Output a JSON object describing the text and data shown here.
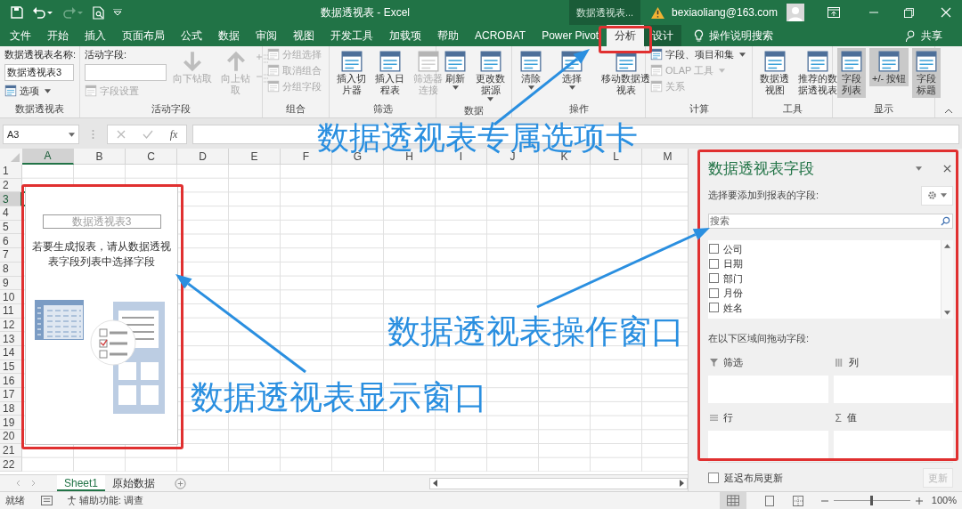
{
  "title_bar": {
    "title": "数据透视表 - Excel",
    "context_label": "数据透视表...",
    "account": "bexiaoliang@163.com"
  },
  "tabs": [
    {
      "label": "文件",
      "selected": false,
      "contextual": false
    },
    {
      "label": "开始",
      "selected": false,
      "contextual": false
    },
    {
      "label": "插入",
      "selected": false,
      "contextual": false
    },
    {
      "label": "页面布局",
      "selected": false,
      "contextual": false
    },
    {
      "label": "公式",
      "selected": false,
      "contextual": false
    },
    {
      "label": "数据",
      "selected": false,
      "contextual": false
    },
    {
      "label": "审阅",
      "selected": false,
      "contextual": false
    },
    {
      "label": "视图",
      "selected": false,
      "contextual": false
    },
    {
      "label": "开发工具",
      "selected": false,
      "contextual": false
    },
    {
      "label": "加载项",
      "selected": false,
      "contextual": false
    },
    {
      "label": "帮助",
      "selected": false,
      "contextual": false
    },
    {
      "label": "ACROBAT",
      "selected": false,
      "contextual": false
    },
    {
      "label": "Power Pivot",
      "selected": false,
      "contextual": false
    },
    {
      "label": "分析",
      "selected": true,
      "contextual": true
    },
    {
      "label": "设计",
      "selected": false,
      "contextual": true
    }
  ],
  "tell_me": "操作说明搜索",
  "share": "共享",
  "ribbon": [
    {
      "label": "数据透视表",
      "items": [
        {
          "kind": "caption",
          "label": "数据透视表名称:"
        },
        {
          "kind": "field",
          "value": "数据透视表3"
        },
        {
          "kind": "menu",
          "label": "选项",
          "disabled": false
        }
      ]
    },
    {
      "label": "活动字段",
      "items": [
        {
          "kind": "caption",
          "label": "活动字段:"
        },
        {
          "kind": "field"
        },
        {
          "kind": "small",
          "label": "字段设置",
          "disabled": true
        },
        {
          "kind": "arrow-down",
          "label": "向下钻取",
          "disabled": true
        },
        {
          "kind": "arrow-up",
          "label": "向上钻取",
          "disabled": true
        },
        {
          "kind": "expand-collapse",
          "disabled": true
        }
      ]
    },
    {
      "label": "组合",
      "items": [
        {
          "kind": "small",
          "label": "分组选择",
          "disabled": true
        },
        {
          "kind": "small",
          "label": "取消组合",
          "disabled": true
        },
        {
          "kind": "small",
          "label": "分组字段",
          "disabled": true
        }
      ]
    },
    {
      "label": "筛选",
      "items": [
        {
          "kind": "big",
          "label": "插入切片器",
          "disabled": false
        },
        {
          "kind": "big",
          "label": "插入日程表",
          "disabled": false
        },
        {
          "kind": "big",
          "label": "筛选器连接",
          "disabled": true
        }
      ]
    },
    {
      "label": "数据",
      "items": [
        {
          "kind": "big-menu",
          "label": "刷新",
          "disabled": false
        },
        {
          "kind": "big-menu",
          "label": "更改数据源",
          "disabled": false
        }
      ]
    },
    {
      "label": "操作",
      "items": [
        {
          "kind": "big-menu",
          "label": "清除",
          "disabled": false
        },
        {
          "kind": "big-menu",
          "label": "选择",
          "disabled": false
        },
        {
          "kind": "big",
          "label": "移动数据透视表",
          "disabled": false
        }
      ]
    },
    {
      "label": "计算",
      "items": [
        {
          "kind": "menu",
          "label": "字段、项目和集",
          "disabled": false
        },
        {
          "kind": "menu",
          "label": "OLAP 工具",
          "disabled": true
        },
        {
          "kind": "small",
          "label": "关系",
          "disabled": true
        }
      ]
    },
    {
      "label": "工具",
      "items": [
        {
          "kind": "big",
          "label": "数据透视图",
          "disabled": false
        },
        {
          "kind": "big",
          "label": "推荐的数据透视表",
          "disabled": false
        }
      ]
    },
    {
      "label": "显示",
      "items": [
        {
          "kind": "toggle",
          "label": "字段列表",
          "selected": true
        },
        {
          "kind": "toggle",
          "label": "+/- 按钮",
          "selected": true
        },
        {
          "kind": "toggle",
          "label": "字段标题",
          "selected": true
        }
      ]
    }
  ],
  "formula_bar": {
    "name_box": "A3",
    "fx": "fx"
  },
  "sheet": {
    "columns": [
      {
        "label": "A",
        "selected": true
      },
      {
        "label": "B",
        "selected": false
      },
      {
        "label": "C",
        "selected": false
      },
      {
        "label": "D",
        "selected": false
      },
      {
        "label": "E",
        "selected": false
      },
      {
        "label": "F",
        "selected": false
      },
      {
        "label": "G",
        "selected": false
      },
      {
        "label": "H",
        "selected": false
      },
      {
        "label": "I",
        "selected": false
      },
      {
        "label": "J",
        "selected": false
      },
      {
        "label": "K",
        "selected": false
      },
      {
        "label": "L",
        "selected": false
      },
      {
        "label": "M",
        "selected": false
      }
    ],
    "rows": [
      {
        "label": "1",
        "selected": false
      },
      {
        "label": "2",
        "selected": false
      },
      {
        "label": "3",
        "selected": true
      },
      {
        "label": "4",
        "selected": false
      },
      {
        "label": "5",
        "selected": false
      },
      {
        "label": "6",
        "selected": false
      },
      {
        "label": "7",
        "selected": false
      },
      {
        "label": "8",
        "selected": false
      },
      {
        "label": "9",
        "selected": false
      },
      {
        "label": "10",
        "selected": false
      },
      {
        "label": "11",
        "selected": false
      },
      {
        "label": "12",
        "selected": false
      },
      {
        "label": "13",
        "selected": false
      },
      {
        "label": "14",
        "selected": false
      },
      {
        "label": "15",
        "selected": false
      },
      {
        "label": "16",
        "selected": false
      },
      {
        "label": "17",
        "selected": false
      },
      {
        "label": "18",
        "selected": false
      },
      {
        "label": "19",
        "selected": false
      },
      {
        "label": "20",
        "selected": false
      },
      {
        "label": "21",
        "selected": false
      },
      {
        "label": "22",
        "selected": false
      }
    ]
  },
  "pivot_placeholder": {
    "name": "数据透视表3",
    "instruction": "若要生成报表，请从数据透视表字段列表中选择字段"
  },
  "sheet_tabs": [
    {
      "label": "Sheet1",
      "selected": true
    },
    {
      "label": "原始数据",
      "selected": false
    }
  ],
  "field_panel": {
    "title": "数据透视表字段",
    "prompt": "选择要添加到报表的字段:",
    "search": {
      "placeholder": "搜索"
    },
    "fields": [
      {
        "label": "公司",
        "checked": false
      },
      {
        "label": "日期",
        "checked": false
      },
      {
        "label": "部门",
        "checked": false
      },
      {
        "label": "月份",
        "checked": false
      },
      {
        "label": "姓名",
        "checked": false
      }
    ],
    "areas_prompt": "在以下区域间拖动字段:",
    "areas": [
      {
        "kind": "filter",
        "label": "筛选"
      },
      {
        "kind": "columns",
        "label": "列"
      },
      {
        "kind": "rows",
        "label": "行"
      },
      {
        "kind": "values",
        "label": "值",
        "symbol": "Σ"
      }
    ],
    "defer_update": {
      "label": "延迟布局更新",
      "checked": false
    },
    "update_button": {
      "label": "更新",
      "disabled": true
    }
  },
  "status_bar": {
    "status": "就绪",
    "accessibility": "辅助功能: 调查",
    "zoom": {
      "level": 0.5,
      "reading": "100%"
    }
  },
  "annotations": [
    {
      "text": "数据透视表专属选项卡"
    },
    {
      "text": "数据透视表操作窗口"
    },
    {
      "text": "数据透视表显示窗口"
    }
  ]
}
